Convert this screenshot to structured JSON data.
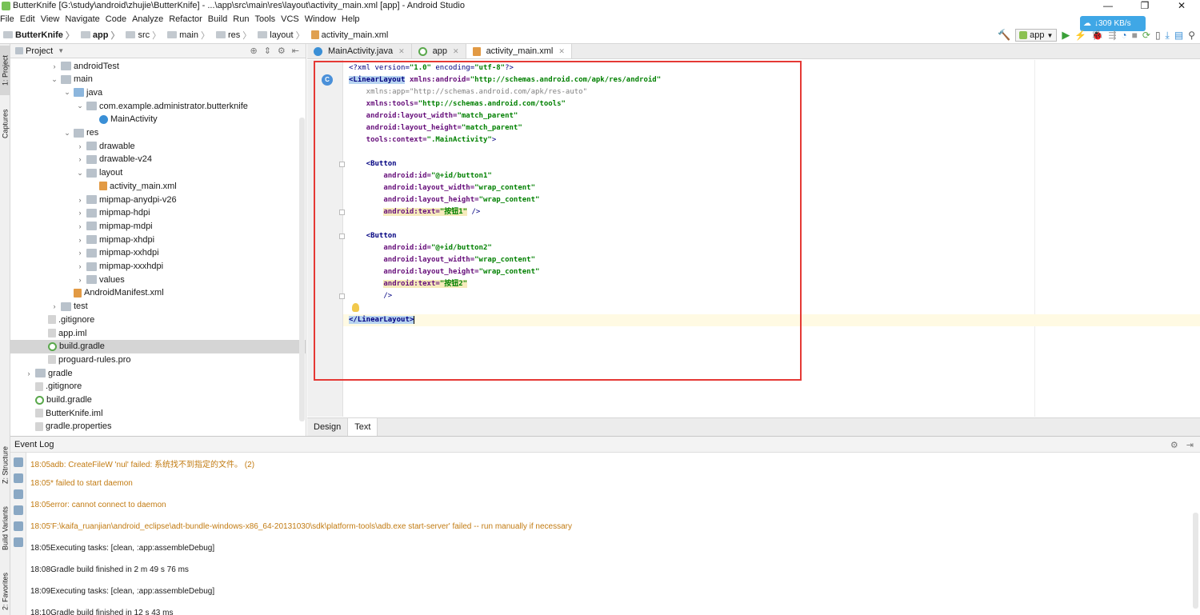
{
  "window": {
    "title": "ButterKnife [G:\\study\\android\\zhujie\\ButterKnife] - ...\\app\\src\\main\\res\\layout\\activity_main.xml [app] - Android Studio",
    "minimize": "—",
    "maximize": "❐",
    "close": "✕"
  },
  "menu": [
    "File",
    "Edit",
    "View",
    "Navigate",
    "Code",
    "Analyze",
    "Refactor",
    "Build",
    "Run",
    "Tools",
    "VCS",
    "Window",
    "Help"
  ],
  "breadcrumb": [
    "ButterKnife",
    "app",
    "src",
    "main",
    "res",
    "layout",
    "activity_main.xml"
  ],
  "toolbar": {
    "run_config": "app"
  },
  "speed_badge": "↓309 KB/s",
  "sidebar_tabs": {
    "project": "1: Project",
    "captures": "Captures",
    "structure": "Z: Structure",
    "build_variants": "Build Variants",
    "favorites": "2: Favorites"
  },
  "project_panel": {
    "title": "Project",
    "items": [
      {
        "label": "androidTest",
        "type": "folder"
      },
      {
        "label": "main",
        "type": "folder"
      },
      {
        "label": "java",
        "type": "folder-blue"
      },
      {
        "label": "com.example.administrator.butterknife",
        "type": "folder"
      },
      {
        "label": "MainActivity",
        "type": "class"
      },
      {
        "label": "res",
        "type": "folder"
      },
      {
        "label": "drawable",
        "type": "folder"
      },
      {
        "label": "drawable-v24",
        "type": "folder"
      },
      {
        "label": "layout",
        "type": "folder"
      },
      {
        "label": "activity_main.xml",
        "type": "xml"
      },
      {
        "label": "mipmap-anydpi-v26",
        "type": "folder"
      },
      {
        "label": "mipmap-hdpi",
        "type": "folder"
      },
      {
        "label": "mipmap-mdpi",
        "type": "folder"
      },
      {
        "label": "mipmap-xhdpi",
        "type": "folder"
      },
      {
        "label": "mipmap-xxhdpi",
        "type": "folder"
      },
      {
        "label": "mipmap-xxxhdpi",
        "type": "folder"
      },
      {
        "label": "values",
        "type": "folder"
      },
      {
        "label": "AndroidManifest.xml",
        "type": "xml"
      },
      {
        "label": "test",
        "type": "folder"
      },
      {
        "label": ".gitignore",
        "type": "file"
      },
      {
        "label": "app.iml",
        "type": "file"
      },
      {
        "label": "build.gradle",
        "type": "gradle"
      },
      {
        "label": "proguard-rules.pro",
        "type": "file"
      },
      {
        "label": "gradle",
        "type": "folder"
      },
      {
        "label": ".gitignore",
        "type": "file"
      },
      {
        "label": "build.gradle",
        "type": "gradle"
      },
      {
        "label": "ButterKnife.iml",
        "type": "file"
      },
      {
        "label": "gradle.properties",
        "type": "file"
      }
    ]
  },
  "editor_tabs": [
    "MainActivity.java",
    "app",
    "activity_main.xml"
  ],
  "code": {
    "l1_a": "<?xml version=",
    "l1_b": "\"1.0\"",
    "l1_c": " encoding=",
    "l1_d": "\"utf-8\"",
    "l1_e": "?>",
    "l2_tag": "<LinearLayout",
    "l2_ns": " xmlns:android=",
    "l2_val": "\"http://schemas.android.com/apk/res/android\"",
    "l3": "    xmlns:app=\"http://schemas.android.com/apk/res-auto\"",
    "l4_ns": "    xmlns:tools=",
    "l4_val": "\"http://schemas.android.com/tools\"",
    "l5_attr": "    android:layout_width=",
    "l5_val": "\"match_parent\"",
    "l6_attr": "    android:layout_height=",
    "l6_val": "\"match_parent\"",
    "l7_attr": "    tools:context=",
    "l7_val": "\".MainActivity\"",
    "l7_end": ">",
    "l9_tag": "    <Button",
    "l10_attr": "        android:id=",
    "l10_val": "\"@+id/button1\"",
    "l11_attr": "        android:layout_width=",
    "l11_val": "\"wrap_content\"",
    "l12_attr": "        android:layout_height=",
    "l12_val": "\"wrap_content\"",
    "l13_attr": "android:text=",
    "l13_val": "\"按钮1\"",
    "l13_end": " />",
    "l15_tag": "    <Button",
    "l16_attr": "        android:id=",
    "l16_val": "\"@+id/button2\"",
    "l17_attr": "        android:layout_width=",
    "l17_val": "\"wrap_content\"",
    "l18_attr": "        android:layout_height=",
    "l18_val": "\"wrap_content\"",
    "l19_attr": "android:text=",
    "l19_val": "\"按钮2\"",
    "l20": "        />",
    "l22": "</LinearLayout>"
  },
  "design_tabs": [
    "Design",
    "Text"
  ],
  "event_log": {
    "title": "Event Log",
    "entries": [
      {
        "time": "18:05",
        "text": "adb: CreateFileW 'nul' failed: 系统找不到指定的文件。 (2)",
        "kind": "warn"
      },
      {
        "time": "18:05",
        "text": "* failed to start daemon",
        "kind": "warn"
      },
      {
        "time": "18:05",
        "text": "error: cannot connect to daemon",
        "kind": "warn"
      },
      {
        "time": "18:05",
        "text": "'F:\\kaifa_ruanjian\\android_eclipse\\adt-bundle-windows-x86_64-20131030\\sdk\\platform-tools\\adb.exe start-server' failed -- run manually if necessary",
        "kind": "warn"
      },
      {
        "time": "18:05",
        "text": "Executing tasks: [clean, :app:assembleDebug]",
        "kind": "info"
      },
      {
        "time": "18:08",
        "text": "Gradle build finished in 2 m 49 s 76 ms",
        "kind": "info"
      },
      {
        "time": "18:09",
        "text": "Executing tasks: [clean, :app:assembleDebug]",
        "kind": "info"
      },
      {
        "time": "18:10",
        "text": "Gradle build finished in 12 s 43 ms",
        "kind": "info"
      }
    ]
  }
}
